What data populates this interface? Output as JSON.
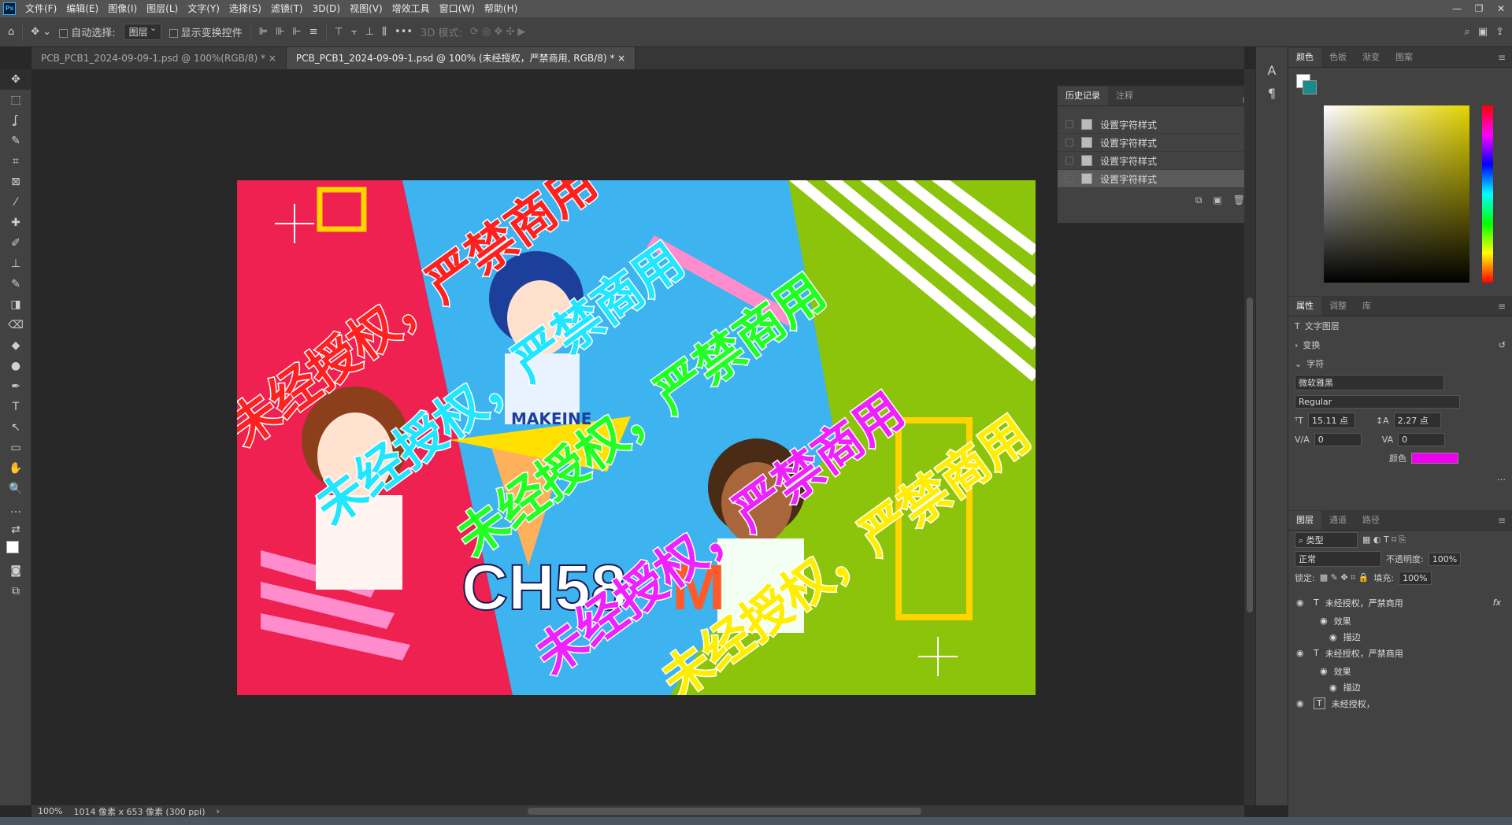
{
  "app": {
    "logo": "Ps"
  },
  "menu": [
    "文件(F)",
    "编辑(E)",
    "图像(I)",
    "图层(L)",
    "文字(Y)",
    "选择(S)",
    "滤镜(T)",
    "3D(D)",
    "视图(V)",
    "增效工具",
    "窗口(W)",
    "帮助(H)"
  ],
  "window_controls": [
    "—",
    "❐",
    "✕"
  ],
  "options": {
    "auto_select_label": "自动选择:",
    "auto_select_value": "图层",
    "show_transform_label": "显示变换控件",
    "mode_3d_label": "3D 模式:"
  },
  "tabs": [
    {
      "label": "PCB_PCB1_2024-09-09-1.psd @ 100%(RGB/8) *",
      "close": "×"
    },
    {
      "label": "PCB_PCB1_2024-09-09-1.psd @ 100% (未经授权，严禁商用, RGB/8) *",
      "close": "×"
    }
  ],
  "tools": [
    "✥",
    "⬚",
    "ʆ",
    "✎",
    "⌗",
    "⊠",
    "⁄",
    "✚",
    "✐",
    "⊥",
    "✎",
    "◨",
    "⌫",
    "◆",
    "●",
    "✒",
    "T",
    "↖",
    "▭",
    "✋",
    "🔍",
    "…"
  ],
  "history": {
    "tabs": [
      "历史记录",
      "注释"
    ],
    "items": [
      "设置字符样式",
      "设置字符样式",
      "设置字符样式",
      "设置字符样式"
    ]
  },
  "artwork": {
    "watermarks": [
      {
        "text": "未经授权，严禁商用",
        "color": "#ff2020"
      },
      {
        "text": "未经授权，严禁商用",
        "color": "#22e5ff"
      },
      {
        "text": "未经授权，严禁商用",
        "color": "#22ff22"
      },
      {
        "text": "未经授权，严禁商用",
        "color": "#ee22ff"
      },
      {
        "text": "未经授权，严禁商用",
        "color": "#ffee00"
      }
    ],
    "logo_text": "CH58",
    "logo_tail": "M",
    "shirt_text": "MAKEINE"
  },
  "right_panel": {
    "color_tabs": [
      "颜色",
      "色板",
      "渐变",
      "图案"
    ],
    "props_tabs": [
      "属性",
      "调整",
      "库"
    ],
    "layer_kind": "文字图层",
    "transform": "变换",
    "character": "字符",
    "font": "微软雅黑",
    "style": "Regular",
    "size": "15.11 点",
    "leading": "2.27 点",
    "kerning": "0",
    "tracking": "0",
    "color_label": "颜色",
    "text_color": "#ee00ee",
    "more": "…",
    "layers_tabs": [
      "图层",
      "通道",
      "路径"
    ],
    "filter_kind": "类型",
    "blend": "正常",
    "opacity_label": "不透明度:",
    "opacity": "100%",
    "lock_label": "锁定:",
    "fill_label": "填充:",
    "fill": "100%",
    "layers": [
      {
        "name": "未经授权，严禁商用",
        "effects": "效果",
        "stroke": "描边"
      },
      {
        "name": "未经授权，严禁商用",
        "effects": "效果",
        "stroke": "描边"
      },
      {
        "name": "未经授权，"
      }
    ]
  },
  "status": {
    "zoom": "100%",
    "dims": "1014 像素 x 653 像素 (300 ppi)"
  }
}
